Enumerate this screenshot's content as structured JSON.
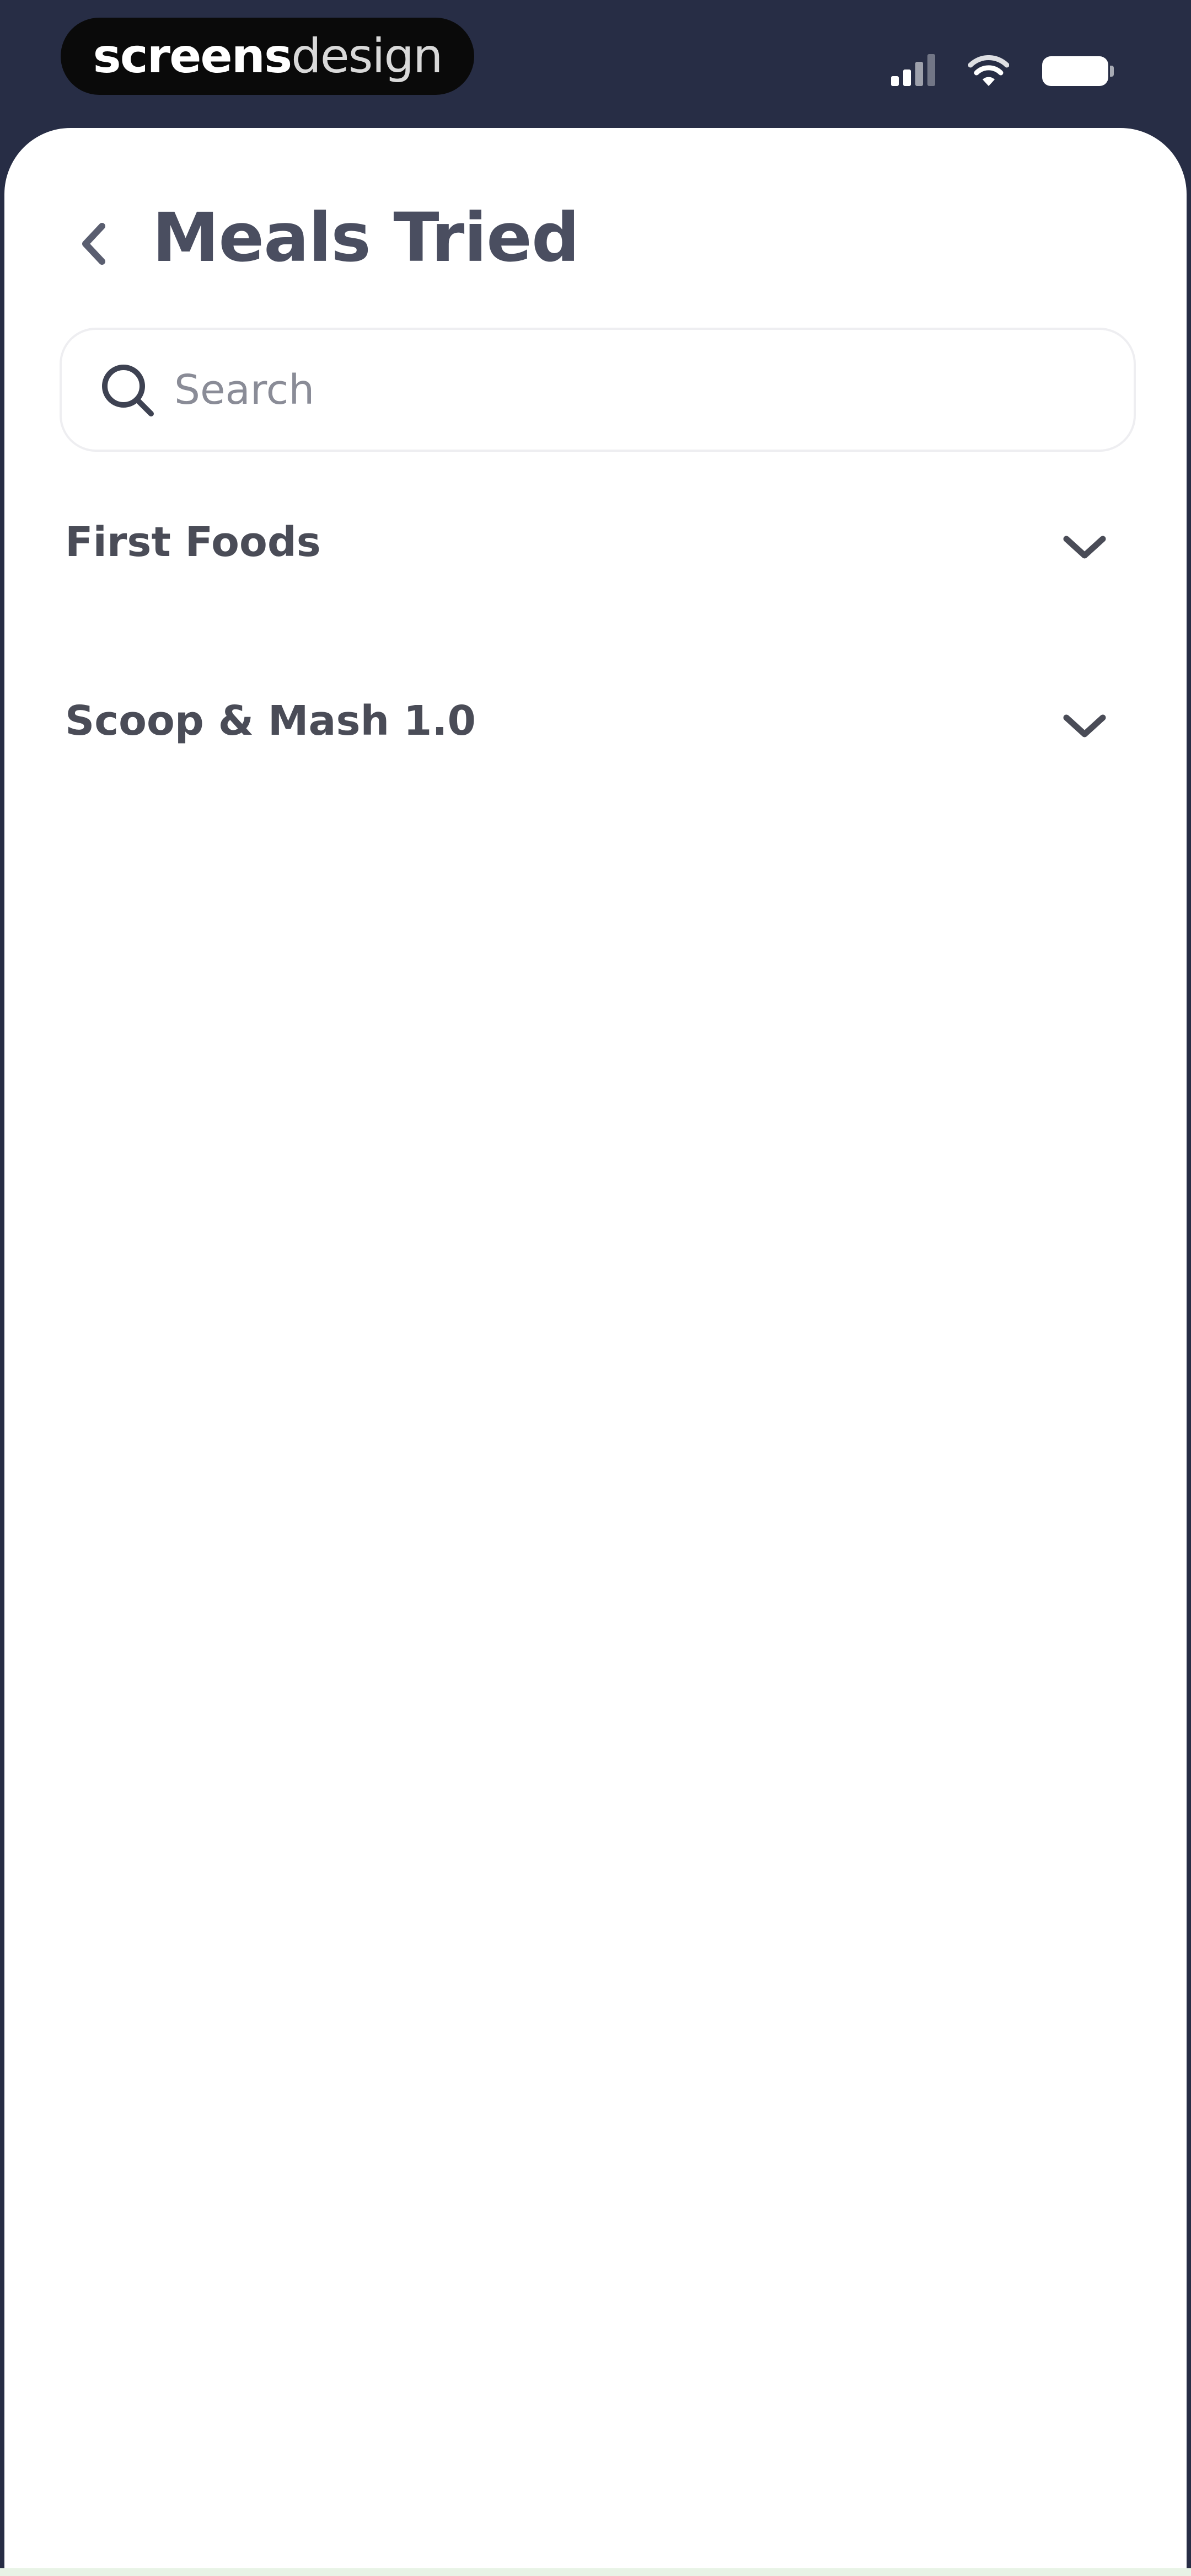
{
  "status_bar": {
    "brand_bold": "screens",
    "brand_light": "design",
    "icons": [
      "cellular-signal-icon",
      "wifi-icon",
      "battery-icon"
    ]
  },
  "header": {
    "back_icon": "chevron-left-icon",
    "title": "Meals Tried"
  },
  "search": {
    "icon": "search-icon",
    "placeholder": "Search",
    "value": ""
  },
  "sections": [
    {
      "label": "First Foods",
      "icon": "chevron-down-icon"
    },
    {
      "label": "Scoop & Mash 1.0",
      "icon": "chevron-down-icon"
    }
  ],
  "colors": {
    "status_bar_bg": "#272d45",
    "title_text": "#4a4e60",
    "section_text": "#4a4c57",
    "placeholder_text": "#8a8c97",
    "search_border": "#eeeef1"
  }
}
